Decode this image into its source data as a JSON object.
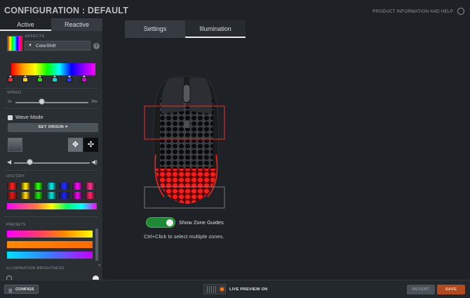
{
  "header": {
    "title": "CONFIGURATION : DEFAULT",
    "product_info": "PRODUCT INFORMATION AND HELP",
    "globe_icon": "globe-icon"
  },
  "left": {
    "tabs": [
      {
        "label": "Active",
        "active": true
      },
      {
        "label": "Reactive",
        "active": false
      }
    ],
    "effects_label": "EFFECTS",
    "effect_value": "ColorShift",
    "help_glyph": "?",
    "gradient_stop_colors": [
      "#ff2a2a",
      "#ffd400",
      "#22e000",
      "#00e0e0",
      "#2a3cff",
      "#e000e0"
    ],
    "speed_label": "SPEED",
    "speed_min": "2s",
    "speed_max": "30s",
    "speed_value_fraction": 0.36,
    "wave_mode_label": "Wave Mode",
    "wave_mode_checked": true,
    "set_origin_label": "SET ORIGIN",
    "volume_fraction": 0.2,
    "history_label": "HISTORY",
    "history_row1": [
      "#ff1a1a",
      "#ffe100",
      "#22ff00",
      "#00e5e5",
      "#1a2bff",
      "#ff00ff",
      "#ff2a88"
    ],
    "history_row2": [
      "#e81111",
      "#ffd000",
      "#18e000",
      "#00dada",
      "#1722ee",
      "#ee00ee",
      "#ff1a66"
    ],
    "presets_label": "PRESETS",
    "presets": [
      {
        "gradient": "linear-gradient(90deg,#ff00ff,#ff3377,#ff8800,#ffff00)"
      },
      {
        "gradient": "linear-gradient(90deg,#ff8800,#ff7a00,#ff6a00)"
      },
      {
        "gradient": "linear-gradient(90deg,#00e0ff,#3a7bff,#c800ff)"
      }
    ],
    "brightness_label": "ILLUMINATION BRIGHTNESS",
    "brightness_help": "?"
  },
  "main": {
    "tabs": [
      {
        "label": "Settings",
        "active": false
      },
      {
        "label": "Illumination",
        "active": true
      }
    ],
    "show_zone_guides_label": "Show Zone Guides",
    "show_zone_guides_on": true,
    "hint": "Ctrl+Click to select multiple zones.",
    "selected_zone_color": "#ff2a2a",
    "bottom_zone_color": "#ff1a1a"
  },
  "footer": {
    "configs_label": "CONFIGS",
    "live_preview_label": "LIVE PREVIEW ON",
    "revert_label": "REVERT",
    "save_label": "SAVE",
    "accent": "#b24a20"
  }
}
